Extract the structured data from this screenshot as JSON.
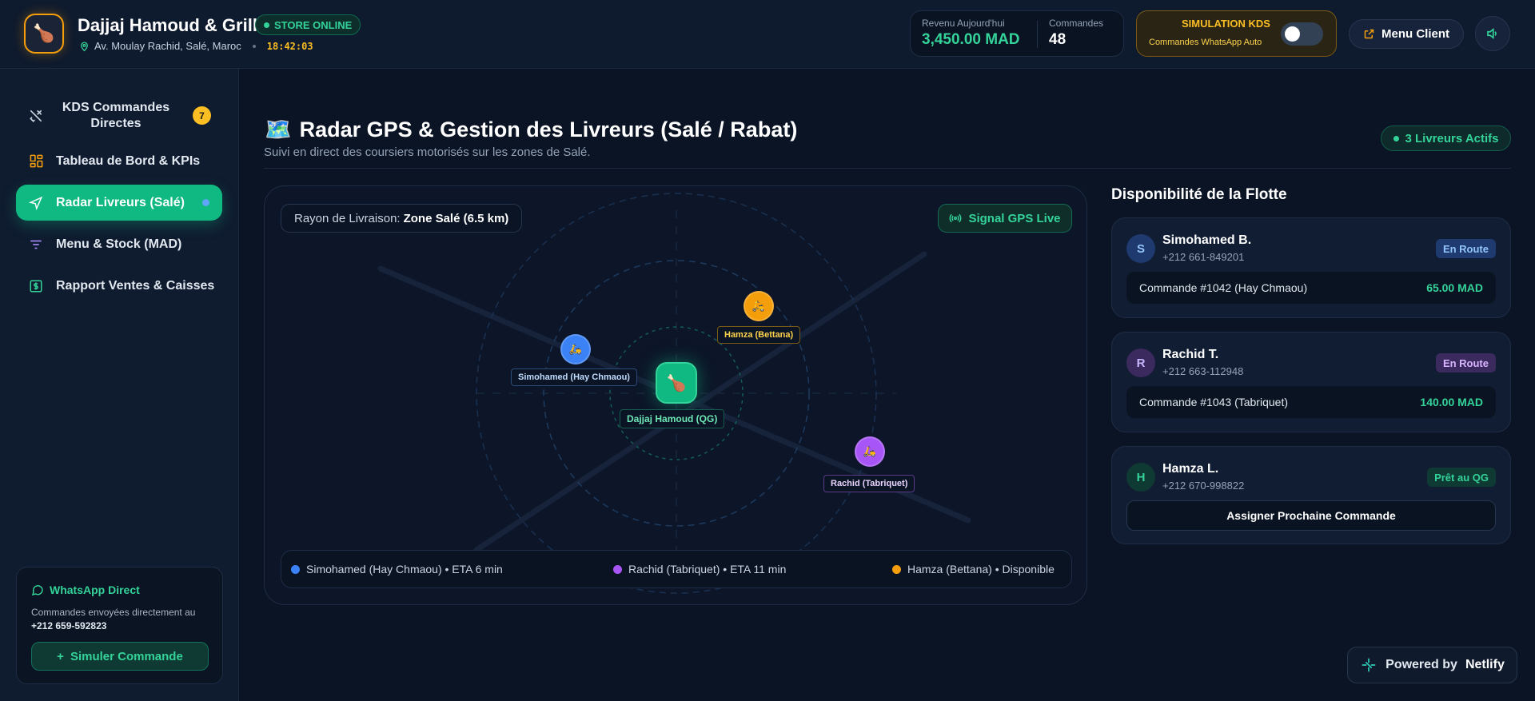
{
  "header": {
    "store_name": "Dajjaj Hamoud & Grill",
    "status": "STORE ONLINE",
    "address": "Av. Moulay Rachid, Salé, Maroc",
    "time": "18:42:03",
    "revenue_label": "Revenu Aujourd'hui",
    "revenue_value": "3,450.00 MAD",
    "orders_label": "Commandes",
    "orders_value": "48",
    "sim_title": "SIMULATION KDS",
    "sim_subtitle": "Commandes WhatsApp Auto",
    "sim_enabled": false,
    "menu_client": "Menu Client",
    "logo_icon": "drumstick-icon"
  },
  "sidebar": {
    "items": [
      {
        "label": "KDS Commandes Directes",
        "icon": "utensils-icon",
        "badge": "7"
      },
      {
        "label": "Tableau de Bord & KPIs",
        "icon": "grid-icon"
      },
      {
        "label": "Radar Livreurs (Salé)",
        "icon": "navigation-icon",
        "active": true
      },
      {
        "label": "Menu & Stock (MAD)",
        "icon": "filter-icon"
      },
      {
        "label": "Rapport Ventes & Caisses",
        "icon": "dollar-icon"
      }
    ],
    "whatsapp": {
      "title": "WhatsApp Direct",
      "text": "Commandes envoyées directement au",
      "phone": "+212 659-592823",
      "button": "Simuler Commande"
    }
  },
  "main": {
    "title_emoji": "🗺️",
    "title": "Radar GPS & Gestion des Livreurs (Salé / Rabat)",
    "subtitle": "Suivi en direct des coursiers motorisés sur les zones de Salé.",
    "active_drivers": "3 Livreurs Actifs",
    "map": {
      "radius_label": "Rayon de Livraison:",
      "radius_value": "Zone Salé (6.5 km)",
      "gps_signal": "Signal GPS Live",
      "hq_label": "Dajjaj Hamoud (QG)",
      "markers": [
        {
          "label": "Simohamed (Hay Chmaou)",
          "color": "#3b82f6"
        },
        {
          "label": "Hamza (Bettana)",
          "color": "#f59e0b"
        },
        {
          "label": "Rachid (Tabriquet)",
          "color": "#a855f7"
        }
      ],
      "legend": [
        {
          "text": "Simohamed (Hay Chmaou) • ETA 6 min",
          "color": "#3b82f6"
        },
        {
          "text": "Rachid (Tabriquet) • ETA 11 min",
          "color": "#a855f7"
        },
        {
          "text": "Hamza (Bettana) • Disponible",
          "color": "#f59e0b"
        }
      ]
    }
  },
  "fleet": {
    "title": "Disponibilité de la Flotte",
    "drivers": [
      {
        "initial": "S",
        "name": "Simohamed B.",
        "phone": "+212 661-849201",
        "status": "En Route",
        "order": "Commande #1042 (Hay Chmaou)",
        "amount": "65.00 MAD"
      },
      {
        "initial": "R",
        "name": "Rachid T.",
        "phone": "+212 663-112948",
        "status": "En Route",
        "order": "Commande #1043 (Tabriquet)",
        "amount": "140.00 MAD"
      },
      {
        "initial": "H",
        "name": "Hamza L.",
        "phone": "+212 670-998822",
        "status": "Prêt au QG",
        "action": "Assigner Prochaine Commande"
      }
    ]
  },
  "footer": {
    "powered_prefix": "Powered by",
    "powered_brand": "Netlify"
  },
  "colors": {
    "accent_green": "#10b981",
    "amber": "#fbbf24",
    "blue": "#3b82f6",
    "purple": "#a855f7",
    "orange": "#f59e0b"
  }
}
